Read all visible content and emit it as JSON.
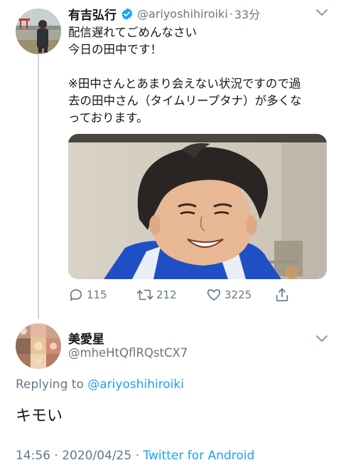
{
  "colors": {
    "link": "#1da1f2",
    "secondary_text": "#657786",
    "primary_text": "#14171a",
    "divider": "#ccd6dd"
  },
  "tweet": {
    "author_name": "有吉弘行",
    "verified_icon": "verified-badge-icon",
    "handle": "@ariyoshihiroiki",
    "separator": "·",
    "time": "33分",
    "lines": [
      "配信遅れてごめんなさい",
      "今日の田中です！",
      "",
      "※田中さんとあまり会えない状況ですので過",
      "去の田中さん（タイムリープタナ）が多くな",
      "っております。"
    ],
    "actions": {
      "reply_count": "115",
      "retweet_count": "212",
      "like_count": "3225"
    },
    "icons": [
      "comment-icon",
      "retweet-icon",
      "heart-icon",
      "share-icon",
      "chevron-down-icon"
    ]
  },
  "reply": {
    "author_name": "美愛星",
    "handle": "@mheHtQflRQstCX7",
    "replying_prefix": "Replying to",
    "replying_to": "@ariyoshihiroiki",
    "text": "キモい",
    "timestamp": "14:56 · 2020/04/25 · ",
    "client": "Twitter for Android"
  }
}
